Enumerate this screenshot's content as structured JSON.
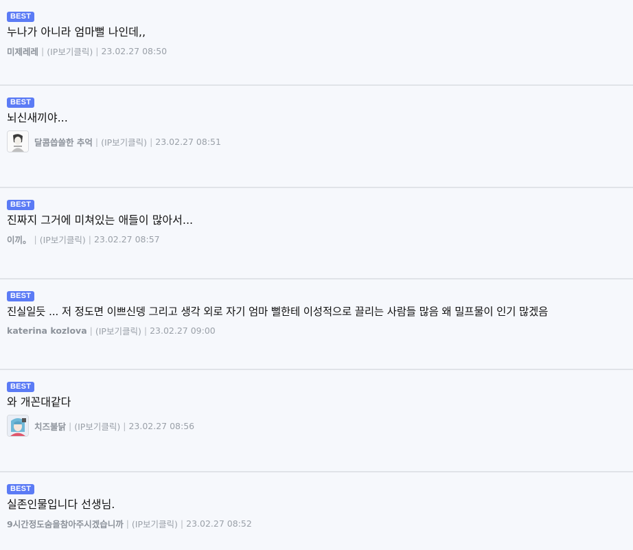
{
  "badge_label": "BEST",
  "separator": "|",
  "comments": [
    {
      "text": "누나가 아니라 엄마뻘 나인데,,",
      "nick": "미제레레",
      "ip": "(IP보기클릭)",
      "time": "23.02.27 08:50"
    },
    {
      "text": "뇌신새끼야...",
      "nick": "달콤씁쓸한 추억",
      "ip": "(IP보기클릭)",
      "time": "23.02.27 08:51"
    },
    {
      "text": "진짜지 그거에 미쳐있는 애들이 많아서...",
      "nick": "이끼。",
      "ip": "(IP보기클릭)",
      "time": "23.02.27 08:57"
    },
    {
      "text": "진실일듯 ... 저 정도면 이쁘신뎅 그리고 생각 외로 자기 엄마 뻘한테 이성적으로 끌리는 사람들 많음 왜 밀프물이 인기 많겠음",
      "nick": "katerina kozlova",
      "ip": "(IP보기클릭)",
      "time": "23.02.27 09:00"
    },
    {
      "text": "와 개꼰대같다",
      "nick": "치즈불닭",
      "ip": "(IP보기클릭)",
      "time": "23.02.27 08:56"
    },
    {
      "text": "실존인물입니다 선생님.",
      "nick": "9시간정도숨을참아주시겠습니까",
      "ip": "(IP보기클릭)",
      "time": "23.02.27 08:52"
    }
  ]
}
